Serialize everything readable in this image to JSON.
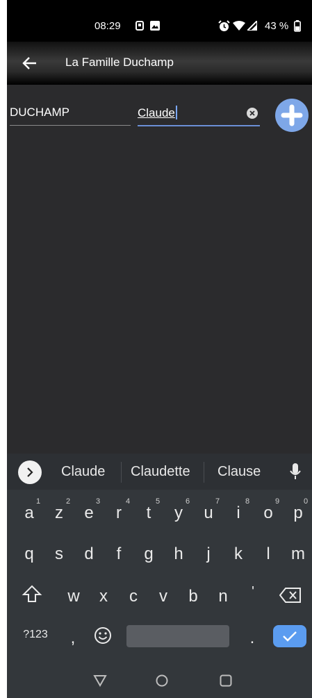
{
  "status": {
    "time": "08:29",
    "battery": "43 %"
  },
  "appbar": {
    "title": "La Famille Duchamp"
  },
  "form": {
    "last_name": "DUCHAMP",
    "first_name": "Claude"
  },
  "suggestions": [
    "Claude",
    "Claudette",
    "Clause"
  ],
  "keyboard": {
    "row1": [
      "a",
      "z",
      "e",
      "r",
      "t",
      "y",
      "u",
      "i",
      "o",
      "p"
    ],
    "row1_hints": [
      "1",
      "2",
      "3",
      "4",
      "5",
      "6",
      "7",
      "8",
      "9",
      "0"
    ],
    "row2": [
      "q",
      "s",
      "d",
      "f",
      "g",
      "h",
      "j",
      "k",
      "l",
      "m"
    ],
    "row3": [
      "w",
      "x",
      "c",
      "v",
      "b",
      "n",
      "'"
    ],
    "symbols_label": "?123",
    "comma": ",",
    "period": "."
  },
  "colors": {
    "accent": "#7ea7e8",
    "enter": "#5b9cf0"
  }
}
